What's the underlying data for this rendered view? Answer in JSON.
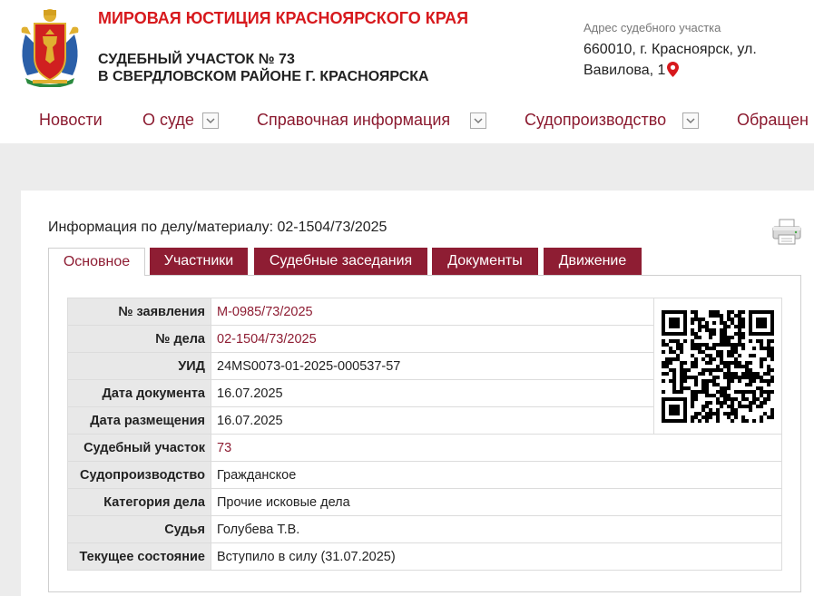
{
  "header": {
    "site_title": "МИРОВАЯ ЮСТИЦИЯ КРАСНОЯРСКОГО КРАЯ",
    "court_line1": "СУДЕБНЫЙ УЧАСТОК № 73",
    "court_line2": "В СВЕРДЛОВСКОМ РАЙОНЕ Г. КРАСНОЯРСКА",
    "address_caption": "Адрес судебного участка",
    "address": "660010, г. Красноярск, ул. Вавилова, 1"
  },
  "nav": {
    "items": [
      {
        "label": "Новости",
        "has_dropdown": false
      },
      {
        "label": "О суде",
        "has_dropdown": true
      },
      {
        "label": "Справочная информация",
        "has_dropdown": true
      },
      {
        "label": "Судопроизводство",
        "has_dropdown": true
      },
      {
        "label": "Обращен",
        "has_dropdown": false
      }
    ]
  },
  "case": {
    "title": "Информация по делу/материалу: 02-1504/73/2025",
    "tabs": [
      {
        "label": "Основное",
        "active": true
      },
      {
        "label": "Участники",
        "active": false
      },
      {
        "label": "Судебные заседания",
        "active": false
      },
      {
        "label": "Документы",
        "active": false
      },
      {
        "label": "Движение",
        "active": false
      }
    ],
    "rows": [
      {
        "label": "№ заявления",
        "value": "М-0985/73/2025",
        "link": true
      },
      {
        "label": "№ дела",
        "value": "02-1504/73/2025",
        "link": true
      },
      {
        "label": "УИД",
        "value": "24MS0073-01-2025-000537-57",
        "link": false
      },
      {
        "label": "Дата документа",
        "value": "16.07.2025",
        "link": false
      },
      {
        "label": "Дата размещения",
        "value": "16.07.2025",
        "link": false
      },
      {
        "label": "Судебный участок",
        "value": "73",
        "link": true
      },
      {
        "label": "Судопроизводство",
        "value": "Гражданское",
        "link": false
      },
      {
        "label": "Категория дела",
        "value": "Прочие исковые дела",
        "link": false
      },
      {
        "label": "Судья",
        "value": "Голубева Т.В.",
        "link": false
      },
      {
        "label": "Текущее состояние",
        "value": "Вступило в силу (31.07.2025)",
        "link": false
      }
    ]
  },
  "icons": {
    "emblem": "krasnoyarsk-coat-of-arms",
    "pin": "map-pin-icon",
    "printer": "printer-icon",
    "dropdown": "chevron-down-icon",
    "qr": "qr-code"
  },
  "colors": {
    "brand_red": "#d7191d",
    "maroon": "#8e1d33",
    "nav_text": "#8b1a2f",
    "label_bg": "#e8e8e8",
    "page_bg": "#ececec"
  }
}
